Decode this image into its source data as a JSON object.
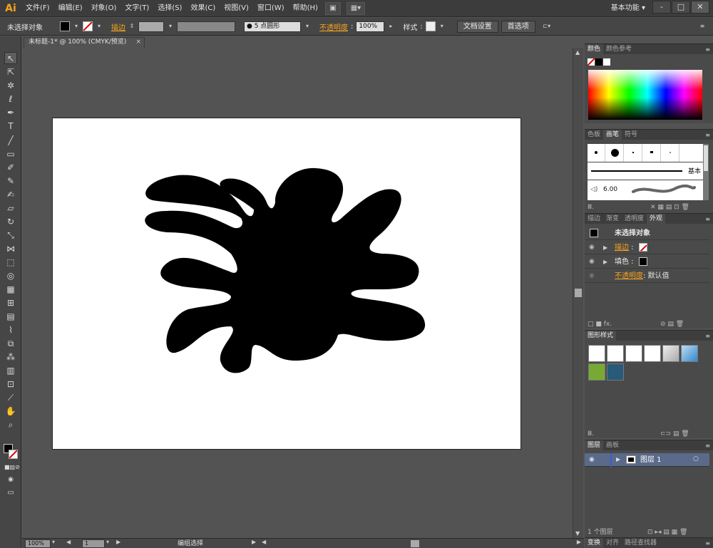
{
  "app": {
    "logo": "Ai",
    "menus": [
      "文件(F)",
      "编辑(E)",
      "对象(O)",
      "文字(T)",
      "选择(S)",
      "效果(C)",
      "视图(V)",
      "窗口(W)",
      "帮助(H)"
    ],
    "workspace": "基本功能",
    "workspace_arrow": "▾",
    "window_buttons": [
      "-",
      "□",
      "✕"
    ]
  },
  "control_bar": {
    "selection": "未选择对象",
    "stroke_label": "描边",
    "brush_value": "5 点圆形",
    "opacity_label": "不透明度",
    "opacity_value": "100%",
    "style_label": "样式",
    "doc_setup": "文档设置",
    "preferences": "首选项"
  },
  "document": {
    "tab_title": "未标题-1* @ 100% (CMYK/预览)",
    "close": "×"
  },
  "status": {
    "zoom": "100%",
    "artboard": "1",
    "tool_status": "编组选择"
  },
  "panels": {
    "color": {
      "tabs": [
        "颜色",
        "颜色参考"
      ]
    },
    "brushes": {
      "tabs": [
        "色板",
        "画笔",
        "符号"
      ],
      "basic_label": "基本",
      "size_label": "6.00"
    },
    "appearance": {
      "tabs": [
        "描边",
        "渐变",
        "透明度",
        "外观"
      ],
      "title": "未选择对象",
      "stroke_label": "描边",
      "fill_label": "填色",
      "opacity_label": "不透明度",
      "opacity_value": "默认值"
    },
    "graphic_styles": {
      "tabs": [
        "图形样式"
      ]
    },
    "layers": {
      "tabs": [
        "图层",
        "画板"
      ],
      "layer_name": "图层 1",
      "count": "1 个图层"
    },
    "bottom": {
      "tabs": [
        "变换",
        "对齐",
        "路径查找器"
      ]
    }
  },
  "colors": {
    "accent": "#f7a31c",
    "ui_dark": "#3c3c3c",
    "ui_mid": "#464646",
    "pasteboard": "#535353",
    "shape": "#000000"
  }
}
